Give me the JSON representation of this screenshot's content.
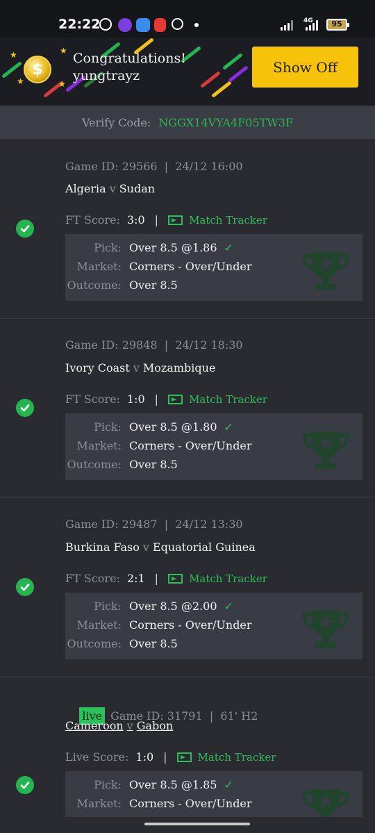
{
  "status_bar": {
    "time": "22:22",
    "app_icons": [
      "pinterest-icon",
      "purple-app-icon",
      "weather-icon",
      "pdf-icon",
      "pinwheel-icon"
    ],
    "network": "4G",
    "battery": "95"
  },
  "banner": {
    "title": "Congratulations!",
    "username": "yungtrayz",
    "button_label": "Show Off",
    "coin_symbol": "$"
  },
  "verify": {
    "label": "Verify Code:",
    "code": "NGGX14VYA4F05TW3F"
  },
  "bets": [
    {
      "live": false,
      "game_id": "Game ID: 29566  |  24/12 16:00",
      "home": "Algeria",
      "away": "Sudan",
      "vs": "v",
      "score_label": "FT Score:",
      "score": "3:0",
      "separator": "|",
      "tracker": "Match Tracker",
      "pick_label": "Pick:",
      "pick": "Over 8.5 @1.86",
      "market_label": "Market:",
      "market": "Corners - Over/Under",
      "outcome_label": "Outcome:",
      "outcome": "Over 8.5"
    },
    {
      "live": false,
      "game_id": "Game ID: 29848  |  24/12 18:30",
      "home": "Ivory Coast",
      "away": "Mozambique",
      "vs": "v",
      "score_label": "FT Score:",
      "score": "1:0",
      "separator": "|",
      "tracker": "Match Tracker",
      "pick_label": "Pick:",
      "pick": "Over 8.5 @1.80",
      "market_label": "Market:",
      "market": "Corners - Over/Under",
      "outcome_label": "Outcome:",
      "outcome": "Over 8.5"
    },
    {
      "live": false,
      "game_id": "Game ID: 29487  |  24/12 13:30",
      "home": "Burkina Faso",
      "away": "Equatorial Guinea",
      "vs": "v",
      "score_label": "FT Score:",
      "score": "2:1",
      "separator": "|",
      "tracker": "Match Tracker",
      "pick_label": "Pick:",
      "pick": "Over 8.5 @2.00",
      "market_label": "Market:",
      "market": "Corners - Over/Under",
      "outcome_label": "Outcome:",
      "outcome": "Over 8.5"
    },
    {
      "live": true,
      "live_label": "live",
      "game_id": "Game ID: 31791  |  61' H2",
      "home": "Cameroon",
      "away": "Gabon",
      "vs": "v",
      "score_label": "Live Score:",
      "score": "1:0",
      "separator": "|",
      "tracker": "Match Tracker",
      "pick_label": "Pick:",
      "pick": "Over 8.5 @1.85",
      "market_label": "Market:",
      "market": "Corners - Over/Under"
    }
  ],
  "colors": {
    "accent_green": "#2fbf5a",
    "button_yellow": "#f7c20a",
    "background": "#2a2b30",
    "pick_box": "#3a3c45"
  }
}
